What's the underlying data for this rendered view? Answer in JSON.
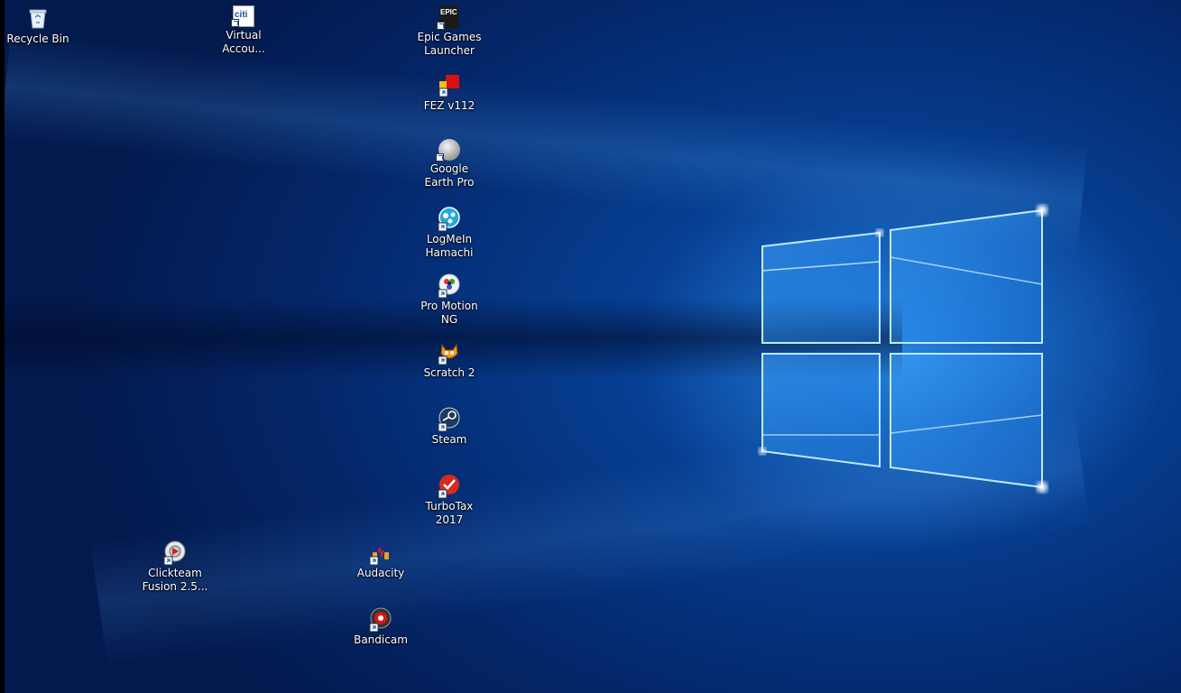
{
  "desktop": {
    "icons": [
      {
        "label": "Recycle Bin",
        "icon": "recycle-bin-icon"
      },
      {
        "label": "Virtual Accou...",
        "icon": "citi-icon"
      },
      {
        "label": "Epic Games Launcher",
        "icon": "epic-games-icon"
      },
      {
        "label": "FEZ v112",
        "icon": "fez-icon"
      },
      {
        "label": "Google Earth Pro",
        "icon": "google-earth-icon"
      },
      {
        "label": "LogMeIn Hamachi",
        "icon": "hamachi-icon"
      },
      {
        "label": "Pro Motion NG",
        "icon": "pro-motion-icon"
      },
      {
        "label": "Scratch 2",
        "icon": "scratch-icon"
      },
      {
        "label": "Steam",
        "icon": "steam-icon"
      },
      {
        "label": "TurboTax 2017",
        "icon": "turbotax-icon"
      },
      {
        "label": "Clickteam Fusion 2.5...",
        "icon": "clickteam-icon"
      },
      {
        "label": "Audacity",
        "icon": "audacity-icon"
      },
      {
        "label": "Bandicam",
        "icon": "bandicam-icon"
      }
    ],
    "citi_text": "citi",
    "epic_text": "EPIC"
  },
  "colors": {
    "wallpaper_dark": "#031a4e",
    "wallpaper_mid": "#0a4fb0",
    "logo_glow": "#7fd0ff"
  }
}
